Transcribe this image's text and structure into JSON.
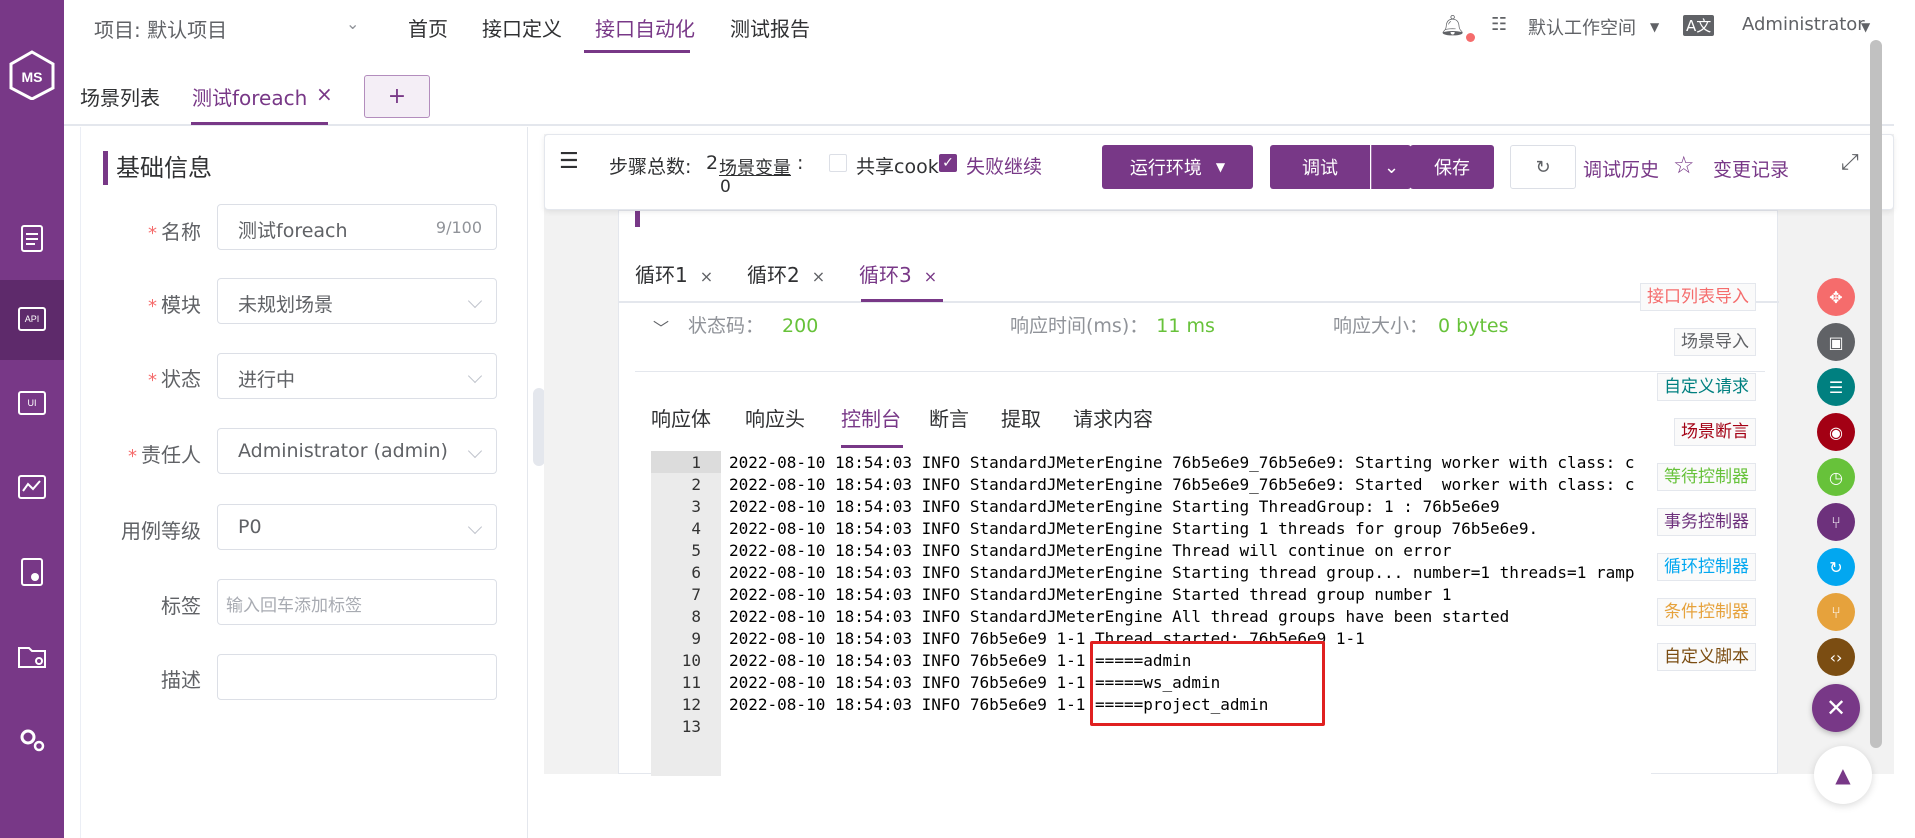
{
  "topbar": {
    "project": "项目: 默认项目",
    "nav": [
      "首页",
      "接口定义",
      "接口自动化",
      "测试报告"
    ],
    "active_nav": "接口自动化",
    "workspace": "默认工作空间",
    "user": "Administrator"
  },
  "tabs": {
    "scene_list": "场景列表",
    "current": "测试foreach",
    "close": "×",
    "add": "+"
  },
  "basic_info": {
    "title": "基础信息",
    "fields": [
      {
        "label": "名称",
        "required": true,
        "value": "测试foreach",
        "suffix": "9/100"
      },
      {
        "label": "模块",
        "required": true,
        "value": "未规划场景"
      },
      {
        "label": "状态",
        "required": true,
        "value": "进行中"
      },
      {
        "label": "责任人",
        "required": true,
        "value": "Administrator (admin)"
      },
      {
        "label": "用例等级",
        "required": false,
        "value": "P0"
      },
      {
        "label": "标签",
        "required": false,
        "placeholder": "输入回车添加标签"
      },
      {
        "label": "描述",
        "required": false,
        "value": ""
      }
    ]
  },
  "toolbar": {
    "step_total_label": "步骤总数:",
    "step_total": "2",
    "scene_var_label": "场景变量",
    "colon": ":",
    "scene_var_count": "0",
    "share_cookie": "共享cook",
    "continue_on_fail": "失败继续",
    "run_env": "运行环境",
    "debug": "调试",
    "save": "保存",
    "debug_history": "调试历史",
    "change_record": "变更记录"
  },
  "response": {
    "loops": [
      "循环1",
      "循环2",
      "循环3"
    ],
    "active_loop": "循环3",
    "status_code_label": "状态码：",
    "status_code": "200",
    "response_time_label": "响应时间(ms)：",
    "response_time": "11 ms",
    "response_size_label": "响应大小：",
    "response_size": "0 bytes",
    "tabs": [
      "响应体",
      "响应头",
      "控制台",
      "断言",
      "提取",
      "请求内容"
    ],
    "active_tab": "控制台",
    "console_lines": [
      "2022-08-10 18:54:03 INFO StandardJMeterEngine 76b5e6e9_76b5e6e9: Starting worker with class: c",
      "2022-08-10 18:54:03 INFO StandardJMeterEngine 76b5e6e9_76b5e6e9: Started  worker with class: c",
      "2022-08-10 18:54:03 INFO StandardJMeterEngine Starting ThreadGroup: 1 : 76b5e6e9",
      "2022-08-10 18:54:03 INFO StandardJMeterEngine Starting 1 threads for group 76b5e6e9.",
      "2022-08-10 18:54:03 INFO StandardJMeterEngine Thread will continue on error",
      "2022-08-10 18:54:03 INFO StandardJMeterEngine Starting thread group... number=1 threads=1 ramp",
      "2022-08-10 18:54:03 INFO StandardJMeterEngine Started thread group number 1",
      "2022-08-10 18:54:03 INFO StandardJMeterEngine All thread groups have been started",
      "2022-08-10 18:54:03 INFO 76b5e6e9 1-1 Thread started: 76b5e6e9 1-1",
      "2022-08-10 18:54:03 INFO 76b5e6e9 1-1 =====admin",
      "2022-08-10 18:54:03 INFO 76b5e6e9 1-1 =====ws_admin",
      "2022-08-10 18:54:03 INFO 76b5e6e9 1-1 =====project_admin",
      ""
    ]
  },
  "insert_panel": [
    {
      "label": "接口列表导入",
      "color": "#f56c6c",
      "icon": "move-icon"
    },
    {
      "label": "场景导入",
      "color": "#606266",
      "icon": "clapper-icon"
    },
    {
      "label": "自定义请求",
      "color": "#008080",
      "icon": "sliders-icon"
    },
    {
      "label": "场景断言",
      "color": "#a30014",
      "icon": "assert-icon"
    },
    {
      "label": "等待控制器",
      "color": "#67c23a",
      "icon": "clock-icon"
    },
    {
      "label": "事务控制器",
      "color": "#6d317c",
      "icon": "branch-icon"
    },
    {
      "label": "循环控制器",
      "color": "#02a7f0",
      "icon": "loop-icon"
    },
    {
      "label": "条件控制器",
      "color": "#e6a23c",
      "icon": "condition-icon"
    },
    {
      "label": "自定义脚本",
      "color": "#7b4d12",
      "icon": "code-icon"
    }
  ],
  "colors": {
    "brand": "#783887",
    "success": "#67c23a",
    "highlight": "#e02020"
  }
}
